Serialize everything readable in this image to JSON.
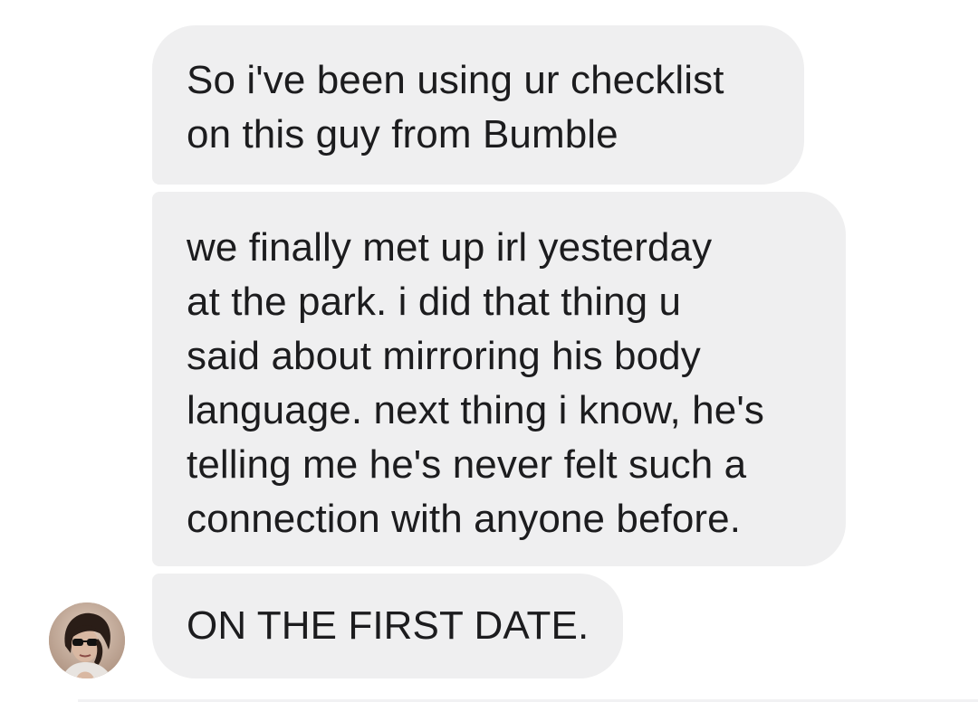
{
  "messages": [
    {
      "lines": [
        "So i've been using ur checklist",
        "on this guy from Bumble"
      ]
    },
    {
      "lines": [
        "we finally met up irl yesterday",
        "at the park. i did that thing u",
        "said about mirroring his body",
        "language. next thing i know, he's",
        "telling me he's never felt such a",
        "connection with anyone before."
      ]
    },
    {
      "lines": [
        "ON THE FIRST DATE."
      ]
    }
  ],
  "colors": {
    "bubble_background": "#efeff0",
    "text": "#1c1c1e",
    "page_background": "#ffffff"
  },
  "icons": {
    "sender_avatar": "sender-avatar-photo"
  }
}
